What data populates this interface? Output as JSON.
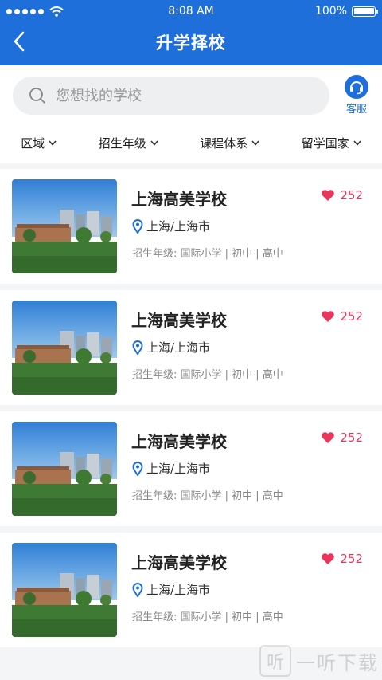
{
  "status_bar": {
    "time": "8:08 AM",
    "battery": "100%"
  },
  "header": {
    "title": "升学择校"
  },
  "search": {
    "placeholder": "您想找的学校"
  },
  "customer_service": {
    "label": "客服"
  },
  "filters": [
    {
      "label": "区域"
    },
    {
      "label": "招生年级"
    },
    {
      "label": "课程体系"
    },
    {
      "label": "留学国家"
    }
  ],
  "schools": [
    {
      "name": "上海高美学校",
      "likes": "252",
      "location": "上海/上海市",
      "grades": "招生年级: 国际小学 | 初中 | 高中"
    },
    {
      "name": "上海高美学校",
      "likes": "252",
      "location": "上海/上海市",
      "grades": "招生年级: 国际小学 | 初中 | 高中"
    },
    {
      "name": "上海高美学校",
      "likes": "252",
      "location": "上海/上海市",
      "grades": "招生年级: 国际小学 | 初中 | 高中"
    },
    {
      "name": "上海高美学校",
      "likes": "252",
      "location": "上海/上海市",
      "grades": "招生年级: 国际小学 | 初中 | 高中"
    }
  ],
  "watermark": {
    "text": "一听下载",
    "glyph": "听"
  },
  "colors": {
    "primary": "#1e6fd9",
    "like": "#e8375a"
  }
}
